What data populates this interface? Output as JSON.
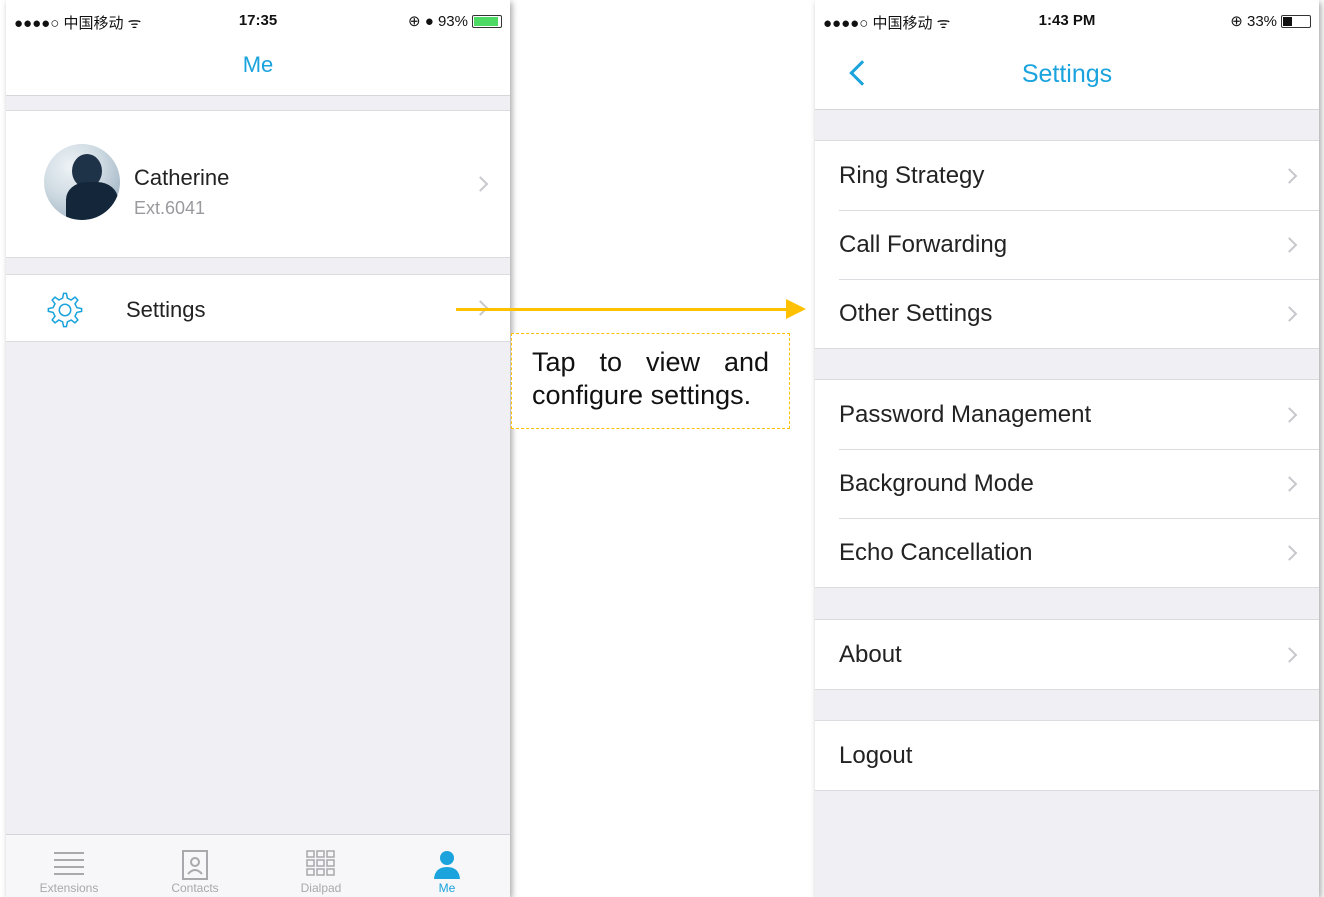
{
  "left_screen": {
    "status": {
      "carrier": "●●●●○ 中国移动 ᯤ",
      "time": "17:35",
      "right": "⊕ ● 93%",
      "battery_level": 0.93
    },
    "title": "Me",
    "profile": {
      "name": "Catherine",
      "extension": "Ext.6041"
    },
    "settings_label": "Settings",
    "tabs": [
      {
        "label": "Extensions",
        "icon": "list-icon"
      },
      {
        "label": "Contacts",
        "icon": "contacts-icon"
      },
      {
        "label": "Dialpad",
        "icon": "dialpad-icon"
      },
      {
        "label": "Me",
        "icon": "person-icon",
        "active": true
      }
    ]
  },
  "annotation": {
    "text": "Tap to view and configure settings."
  },
  "right_screen": {
    "status": {
      "carrier": "●●●●○ 中国移动 ᯤ",
      "time": "1:43 PM",
      "right": "⊕ 33%",
      "battery_level": 0.33
    },
    "title": "Settings",
    "groups": [
      [
        "Ring Strategy",
        "Call Forwarding",
        "Other Settings"
      ],
      [
        "Password Management",
        "Background Mode",
        "Echo Cancellation"
      ],
      [
        "About"
      ],
      [
        "Logout"
      ]
    ]
  },
  "colors": {
    "accent": "#1aa3dc",
    "annotation": "#ffc000",
    "background": "#efeff4"
  }
}
